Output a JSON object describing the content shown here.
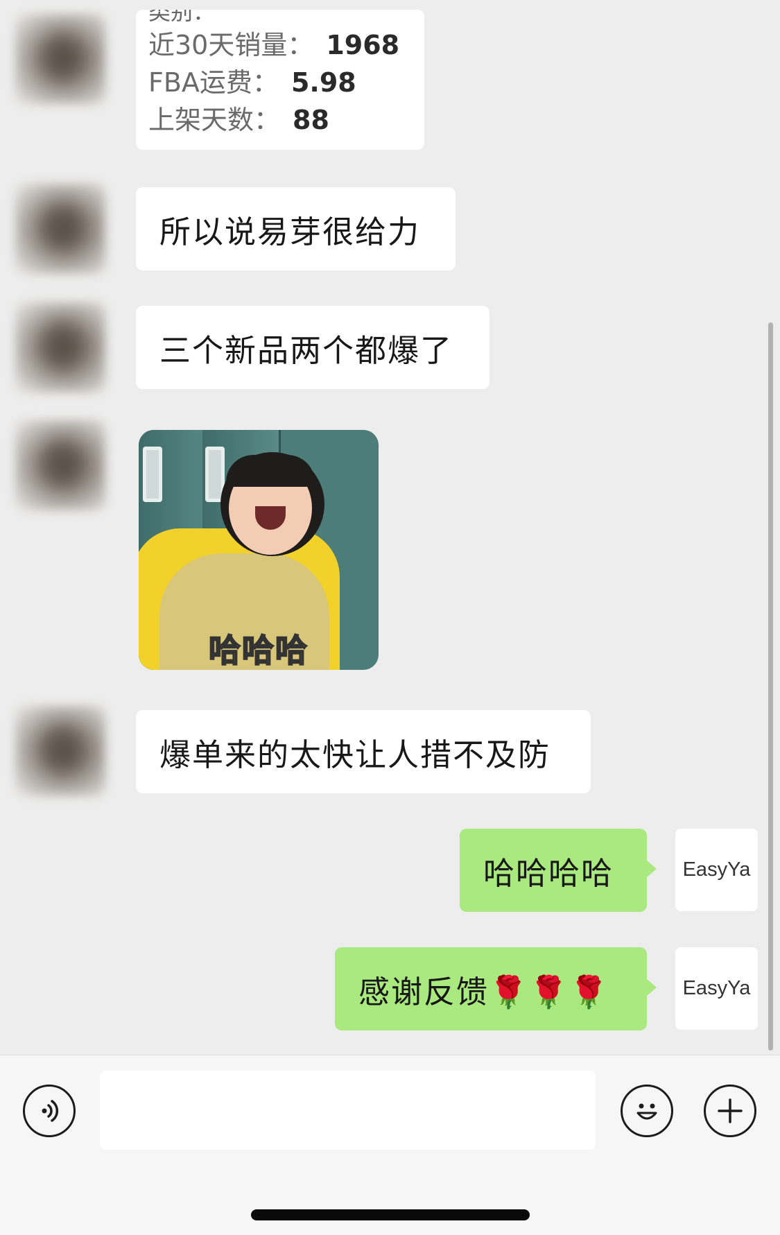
{
  "chat": {
    "card": {
      "cut_text": "类别：",
      "rows": [
        {
          "label": "近30天销量：",
          "value": "1968"
        },
        {
          "label": "FBA运费：",
          "value": "5.98"
        },
        {
          "label": "上架天数：",
          "value": "88"
        }
      ]
    },
    "messages": [
      {
        "text": "所以说易芽很给力"
      },
      {
        "text": "三个新品两个都爆了"
      },
      {
        "text": "爆单来的太快让人措不及防"
      }
    ],
    "sticker": {
      "caption": "哈哈哈"
    },
    "outgoing": [
      {
        "text": "哈哈哈哈"
      },
      {
        "text": "感谢反馈🌹🌹🌹"
      }
    ],
    "my_avatar_text": "EasyYa"
  },
  "input_bar": {
    "voice_icon": "voice-icon",
    "emoji_icon": "emoji-icon",
    "plus_icon": "plus-icon",
    "input_value": ""
  },
  "colors": {
    "background": "#ededed",
    "incoming_bubble": "#ffffff",
    "outgoing_bubble": "#a9e97f",
    "input_bar": "#f6f6f6"
  }
}
